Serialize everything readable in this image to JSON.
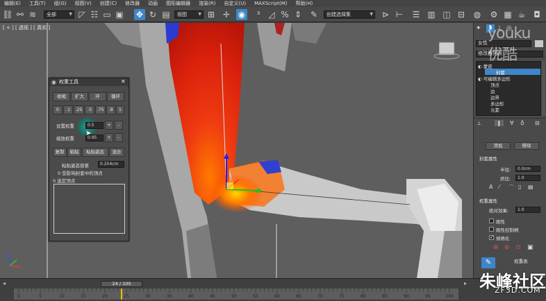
{
  "menubar": {
    "items": [
      "编辑(E)",
      "工具(T)",
      "组(G)",
      "视图(V)",
      "创建(C)",
      "修改器",
      "动画",
      "图形编辑器",
      "渲染(R)",
      "自定义(U)",
      "MAXScript(M)",
      "帮助(H)"
    ]
  },
  "toolbar": {
    "filter_select": "全部",
    "coord_select": "视图",
    "selection_set": "创建选择集"
  },
  "viewport": {
    "label": "[ + ] [ 透视 ] [ 真实 ]"
  },
  "weight_tool": {
    "title": "权重工具",
    "row1": [
      "收缩",
      "扩大",
      "环",
      "循环"
    ],
    "presets": [
      "0",
      ".1",
      ".25",
      ".5",
      ".75",
      ".9",
      "1"
    ],
    "set_weight_label": "设置权重",
    "set_weight_value": "0.5",
    "scale_weight_label": "缩放权重",
    "scale_weight_value": "0.95",
    "plus": "+",
    "minus": "-",
    "row3": [
      "复制",
      "粘贴",
      "粘贴姿态",
      "混合"
    ],
    "paste_tol_label": "粘贴姿态容差",
    "paste_tol_value": "0.254cm",
    "influence_text": "0 受影响封套中的顶点",
    "selected_text": "0 选定顶点"
  },
  "command_panel": {
    "object_name": "女性",
    "modifier_list": "修改器列表",
    "stack": [
      "蒙皮",
      "封套",
      "可编辑多边形",
      "顶点",
      "边",
      "边界",
      "多边形",
      "元素"
    ],
    "add_button": "添加",
    "remove_button": "移除",
    "envelope_props": "封套属性",
    "radius_label": "半径:",
    "radius_value": "0.0cm",
    "squash_label": "挤压:",
    "squash_value": "1.0",
    "weight_props": "权重属性",
    "abs_effect_label": "绝对效果:",
    "abs_effect_value": "1.0",
    "rigid_label": "刚性",
    "rigid_handles_label": "刚性控制柄",
    "normalize_label": "规格化",
    "weight_table_button": "权重表"
  },
  "timeline": {
    "slider": "24 / 100",
    "ticks": [
      "0",
      "5",
      "10",
      "15",
      "20",
      "25",
      "30",
      "35",
      "40",
      "45",
      "50",
      "55",
      "60",
      "65",
      "70",
      "75",
      "80",
      "85",
      "90",
      "95",
      "100"
    ]
  },
  "watermarks": {
    "youku": "youku 优酷",
    "site": "朱峰社区",
    "url": "ZF3D.COM"
  }
}
